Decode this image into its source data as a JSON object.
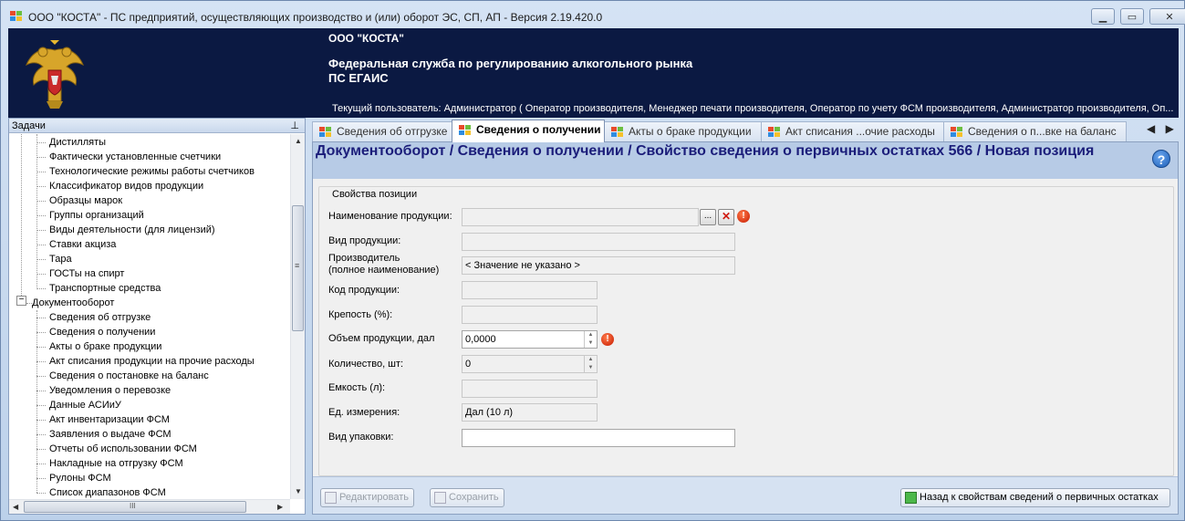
{
  "window": {
    "title": "ООО \"КОСТА\" - ПС предприятий, осуществляющих производство и (или) оборот ЭС, СП, АП - Версия 2.19.420.0",
    "minimize_glyph": "▁",
    "maximize_glyph": "▭",
    "close_glyph": "✕"
  },
  "banner": {
    "org": "ООО \"КОСТА\"",
    "agency": "Федеральная служба по регулированию алкогольного рынка",
    "system": "ПС ЕГАИС",
    "user": "Текущий пользователь: Администратор ( Оператор производителя, Менеджер печати производителя, Оператор по учету ФСМ производителя, Администратор производителя, Оп..."
  },
  "tasks": {
    "title": "Задачи",
    "pin_glyph": "⊥",
    "group_top": [
      "Дистилляты",
      "Фактически установленные счетчики",
      "Технологические режимы работы счетчиков",
      "Классификатор видов продукции",
      "Образцы марок",
      "Группы организаций",
      "Виды деятельности (для лицензий)",
      "Ставки акциза",
      "Тара",
      "ГОСТы на спирт",
      "Транспортные средства"
    ],
    "section": "Документооборот",
    "section_toggle": "−",
    "section_items": [
      "Сведения об отгрузке",
      "Сведения о получении",
      "Акты о браке продукции",
      "Акт списания продукции на прочие расходы",
      "Сведения о постановке на баланс",
      "Уведомления о перевозке",
      "Данные АСИиУ",
      "Акт инвентаризации ФСМ",
      "Заявления о выдаче ФСМ",
      "Отчеты об использовании ФСМ",
      "Накладные на отгрузку ФСМ",
      "Рулоны ФСМ",
      "Список диапазонов ФСМ"
    ],
    "scroll_up": "▲",
    "scroll_down": "▼",
    "scroll_left": "◀",
    "scroll_right": "▶",
    "hthumb_grip": "III",
    "vthumb_grip": "≡"
  },
  "tabs": [
    {
      "label": "Сведения об отгрузке",
      "active": false
    },
    {
      "label": "Сведения о получении",
      "active": true
    },
    {
      "label": "Акты о браке продукции",
      "active": false
    },
    {
      "label": "Акт списания ...очие расходы",
      "active": false
    },
    {
      "label": "Сведения о п...вке на баланс",
      "active": false
    }
  ],
  "tab_nav": {
    "prev": "◀",
    "next": "▶"
  },
  "document": {
    "title": "Документооборот  / Сведения о получении / Свойство сведения о первичных остатках 566 / Новая позиция",
    "help_glyph": "?"
  },
  "form": {
    "group_label": "Свойства позиции",
    "fields": {
      "product_name": {
        "label": "Наименование продукции:",
        "value": ""
      },
      "product_type": {
        "label": "Вид продукции:",
        "value": ""
      },
      "manufacturer": {
        "label_line1": "Производитель",
        "label_line2": "(полное наименование)",
        "value": "< Значение не указано >"
      },
      "product_code": {
        "label": "Код продукции:",
        "value": ""
      },
      "strength": {
        "label": "Крепость (%):",
        "value": ""
      },
      "volume": {
        "label": "Объем продукции, дал",
        "value": "0,0000"
      },
      "quantity": {
        "label": "Количество, шт:",
        "value": "0"
      },
      "capacity": {
        "label": "Емкость (л):",
        "value": ""
      },
      "unit": {
        "label": "Ед. измерения:",
        "value": "Дал (10 л)"
      },
      "package_type": {
        "label": "Вид упаковки:",
        "value": ""
      }
    },
    "browse_glyph": "...",
    "clear_glyph": "✕",
    "error_glyph": "!",
    "spin_up": "▲",
    "spin_down": "▼"
  },
  "buttons": {
    "edit": "Редактировать",
    "save": "Сохранить",
    "back": "Назад к свойствам сведений о первичных остатках"
  },
  "colors": {
    "banner_bg": "#0b1942",
    "title_band": "#b7cbe6",
    "title_text": "#1b1d7a",
    "error": "#c61a00"
  }
}
